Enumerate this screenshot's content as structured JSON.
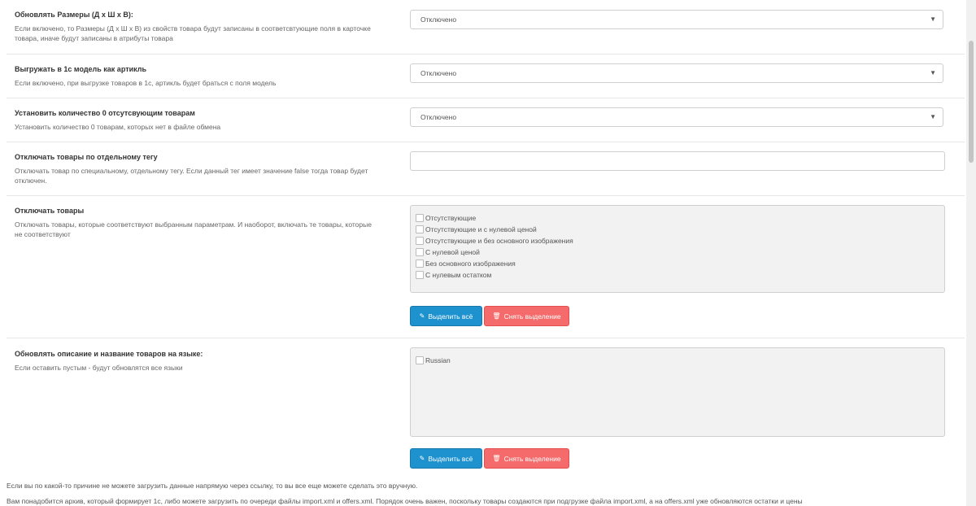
{
  "settings": [
    {
      "title": "Обновлять Размеры (Д х Ш х В):",
      "desc": "Если включено, то Размеры (Д х Ш х В) из свойств товара будут записаны в соответсвтующие поля в карточке товара, иначе будут записаны в атрибуты товара",
      "value": "Отключено"
    },
    {
      "title": "Выгружать в 1с модель как артикль",
      "desc": "Если включено, при выгрузке товаров в 1с, артикль будет браться с поля модель",
      "value": "Отключено"
    },
    {
      "title": "Установить количество 0 отсутсвующим товарам",
      "desc": "Установить количество 0 товарам, которых нет в файле обмена",
      "value": "Отключено"
    },
    {
      "title": "Отключать товары по отдельному тегу",
      "desc": "Отключать товар по специальному, отдельному тегу. Если данный тег имеет значение false тогда товар будет отключен.",
      "value": ""
    },
    {
      "title": "Отключать товары",
      "desc": "Отключать товары, которые соответствуют выбранным параметрам. И наоборот, включать те товары, которые не соответствуют",
      "options": [
        "Отсутствующие",
        "Отсутствующие и с нулевой ценой",
        "Отсутствующие и без основного изображения",
        "С нулевой ценой",
        "Без основного изображения",
        "С нулевым остатком"
      ]
    },
    {
      "title": "Обновлять описание и название товаров на языке:",
      "desc": "Если оставить пустым - будут обновлятся все языки",
      "options": [
        "Russian"
      ]
    }
  ],
  "buttons": {
    "select_all": "Выделить всё",
    "deselect": "Снять выделение"
  },
  "footer": {
    "line1": "Если вы по какой-то причине не можете загрузить данные напрямую через ссылку, то вы все еще можете сделать это вручную.",
    "line2": "Вам понадобится архив, который формирует 1с, либо можете загрузить по очереди файлы import.xml и offers.xml. Порядок очень важен, поскольку товары создаются при подгрузке файла import.xml, а на offers.xml уже обновляются остатки и цены"
  },
  "colors": {
    "primary": "#1e91cf",
    "danger": "#f56b6b"
  }
}
